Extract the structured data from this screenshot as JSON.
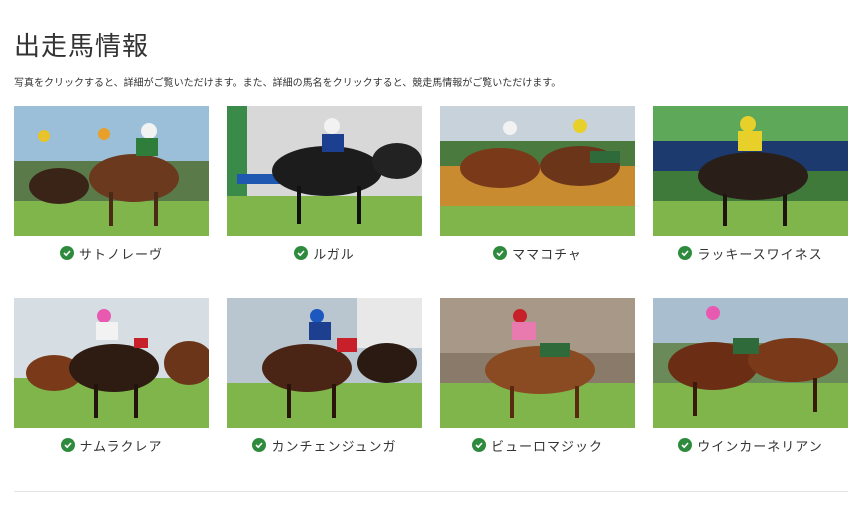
{
  "page": {
    "title": "出走馬情報",
    "description": "写真をクリックすると、詳細がご覧いただけます。また、詳細の馬名をクリックすると、競走馬情報がご覧いただけます。"
  },
  "colors": {
    "check_green": "#2e8b3d",
    "turf_green": "#6fae3d",
    "text": "#333333",
    "divider": "#e4e4e4"
  },
  "horses": [
    {
      "name": "サトノレーヴ",
      "icon": "check-circle-icon"
    },
    {
      "name": "ルガル",
      "icon": "check-circle-icon"
    },
    {
      "name": "ママコチャ",
      "icon": "check-circle-icon"
    },
    {
      "name": "ラッキースワイネス",
      "icon": "check-circle-icon"
    },
    {
      "name": "ナムラクレア",
      "icon": "check-circle-icon"
    },
    {
      "name": "カンチェンジュンガ",
      "icon": "check-circle-icon"
    },
    {
      "name": "ビューロマジック",
      "icon": "check-circle-icon"
    },
    {
      "name": "ウインカーネリアン",
      "icon": "check-circle-icon"
    }
  ]
}
